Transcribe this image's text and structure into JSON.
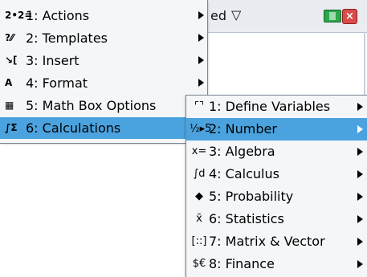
{
  "window": {
    "title_fragment": "ed",
    "chevron": "▽",
    "close": "×",
    "battery_icon": "battery-icon",
    "close_icon": "close-icon"
  },
  "main_menu": {
    "items": [
      {
        "icon": "actions-icon",
        "icon_glyph": "2•2=",
        "label": "1: Actions",
        "arrow": true,
        "selected": false
      },
      {
        "icon": "templates-icon",
        "icon_glyph": "?⁄⁄",
        "label": "2: Templates",
        "arrow": true,
        "selected": false
      },
      {
        "icon": "insert-icon",
        "icon_glyph": "↘[",
        "label": "3: Insert",
        "arrow": true,
        "selected": false
      },
      {
        "icon": "format-icon",
        "icon_glyph": "A",
        "label": "4: Format",
        "arrow": true,
        "selected": false
      },
      {
        "icon": "math-box-options-icon",
        "icon_glyph": "▦",
        "label": "5: Math Box Options",
        "arrow": false,
        "selected": false
      },
      {
        "icon": "calculations-icon",
        "icon_glyph": "∫Σ",
        "label": "6: Calculations",
        "arrow": false,
        "selected": true
      }
    ]
  },
  "sub_menu": {
    "items": [
      {
        "icon": "define-variables-icon",
        "icon_glyph": "⌜⌝",
        "label": "1: Define Variables",
        "arrow": true,
        "selected": false
      },
      {
        "icon": "number-icon",
        "icon_glyph": "½▸5",
        "label": "2: Number",
        "arrow": true,
        "selected": true
      },
      {
        "icon": "algebra-icon",
        "icon_glyph": "x=",
        "label": "3: Algebra",
        "arrow": true,
        "selected": false
      },
      {
        "icon": "calculus-icon",
        "icon_glyph": "∫d",
        "label": "4: Calculus",
        "arrow": true,
        "selected": false
      },
      {
        "icon": "probability-icon",
        "icon_glyph": "◆",
        "label": "5: Probability",
        "arrow": true,
        "selected": false
      },
      {
        "icon": "statistics-icon",
        "icon_glyph": "x̄",
        "label": "6: Statistics",
        "arrow": true,
        "selected": false
      },
      {
        "icon": "matrix-vector-icon",
        "icon_glyph": "[::]",
        "label": "7: Matrix & Vector",
        "arrow": true,
        "selected": false
      },
      {
        "icon": "finance-icon",
        "icon_glyph": "$€",
        "label": "8: Finance",
        "arrow": true,
        "selected": false
      }
    ]
  },
  "cursor_icon": "mouse-pointer-icon"
}
